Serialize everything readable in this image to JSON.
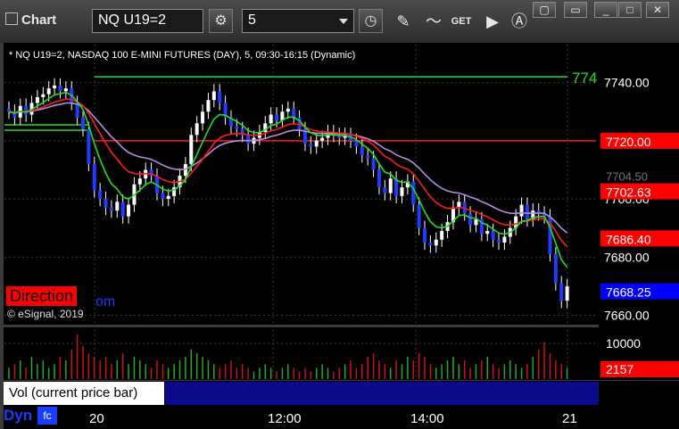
{
  "toolbar": {
    "title": "Chart",
    "symbol": "NQ U19=2",
    "interval": "5",
    "get_label": "GET"
  },
  "chart": {
    "subtitle": "* NQ U19=2, NASDAQ 100 E-MINI FUTURES (DAY), 5, 09:30-16:15 (Dynamic)",
    "direction_label": "Direction",
    "partial_link": "om",
    "copyright": "© eSignal, 2019",
    "hline_green_label": "774",
    "volume_label": "Vol (current price bar)",
    "dyn_label": "Dyn",
    "colors": {
      "up": "#ffffff",
      "down": "#1f3dff",
      "ema_red": "#ff1a1a",
      "ema_green": "#22dd22",
      "ema_purple": "#b08ce0",
      "grid": "#3a3a3a"
    }
  },
  "chart_data": {
    "type": "candlestick",
    "title": "NQ U19=2, NASDAQ 100 E-MINI FUTURES (DAY), 5, 09:30-16:15 (Dynamic)",
    "ylim": [
      7658,
      7750
    ],
    "y_ticks": [
      "7740.00",
      "7720.00",
      "7700.00",
      "7680.00",
      "7660.00"
    ],
    "x_ticks": [
      "20",
      "12:00",
      "14:00",
      "21"
    ],
    "price_badges": [
      {
        "value": "7720.00",
        "color": "#ff0000"
      },
      {
        "value": "7702.63",
        "color": "#ff0000"
      },
      {
        "value": "7686.40",
        "color": "#ff0000"
      },
      {
        "value": "7668.25",
        "color": "#0000ff"
      }
    ],
    "faint_label": "7704.50",
    "horizontal_lines": [
      {
        "value": 7742.0,
        "color": "#22dd22"
      },
      {
        "value": 7720.0,
        "color": "#ff1a1a"
      }
    ],
    "volume_ticks": [
      "10000",
      "2157"
    ],
    "closes": [
      7730,
      7728,
      7732,
      7729,
      7733,
      7735,
      7736,
      7738,
      7739,
      7737,
      7738,
      7733,
      7728,
      7724,
      7712,
      7703,
      7700,
      7697,
      7696,
      7699,
      7694,
      7698,
      7705,
      7707,
      7710,
      7708,
      7702,
      7700,
      7701,
      7704,
      7708,
      7712,
      7722,
      7726,
      7730,
      7734,
      7737,
      7733,
      7728,
      7725,
      7724,
      7722,
      7719,
      7721,
      7723,
      7726,
      7729,
      7727,
      7730,
      7731,
      7728,
      7724,
      7719,
      7718,
      7720,
      7721,
      7723,
      7722,
      7721,
      7722,
      7720,
      7718,
      7715,
      7714,
      7710,
      7704,
      7702,
      7707,
      7701,
      7704,
      7706,
      7698,
      7690,
      7685,
      7684,
      7686,
      7689,
      7692,
      7697,
      7699,
      7695,
      7691,
      7693,
      7688,
      7689,
      7686,
      7685,
      7687,
      7690,
      7694,
      7698,
      7693,
      7696,
      7695,
      7694,
      7681,
      7671,
      7665,
      7670
    ],
    "volumes": [
      3,
      4,
      5,
      3,
      6,
      4,
      5,
      3,
      4,
      6,
      5,
      8,
      12,
      9,
      7,
      6,
      5,
      6,
      4,
      5,
      7,
      4,
      6,
      5,
      4,
      3,
      5,
      4,
      3,
      4,
      5,
      6,
      8,
      7,
      6,
      5,
      4,
      3,
      4,
      5,
      3,
      4,
      3,
      2,
      3,
      4,
      3,
      2,
      3,
      4,
      3,
      2,
      3,
      2,
      3,
      4,
      3,
      2,
      3,
      4,
      5,
      3,
      4,
      6,
      7,
      5,
      4,
      3,
      5,
      4,
      6,
      5,
      7,
      6,
      4,
      3,
      4,
      5,
      6,
      4,
      5,
      3,
      4,
      5,
      6,
      4,
      3,
      4,
      5,
      4,
      3,
      4,
      6,
      8,
      10,
      7,
      5,
      4,
      3
    ]
  }
}
